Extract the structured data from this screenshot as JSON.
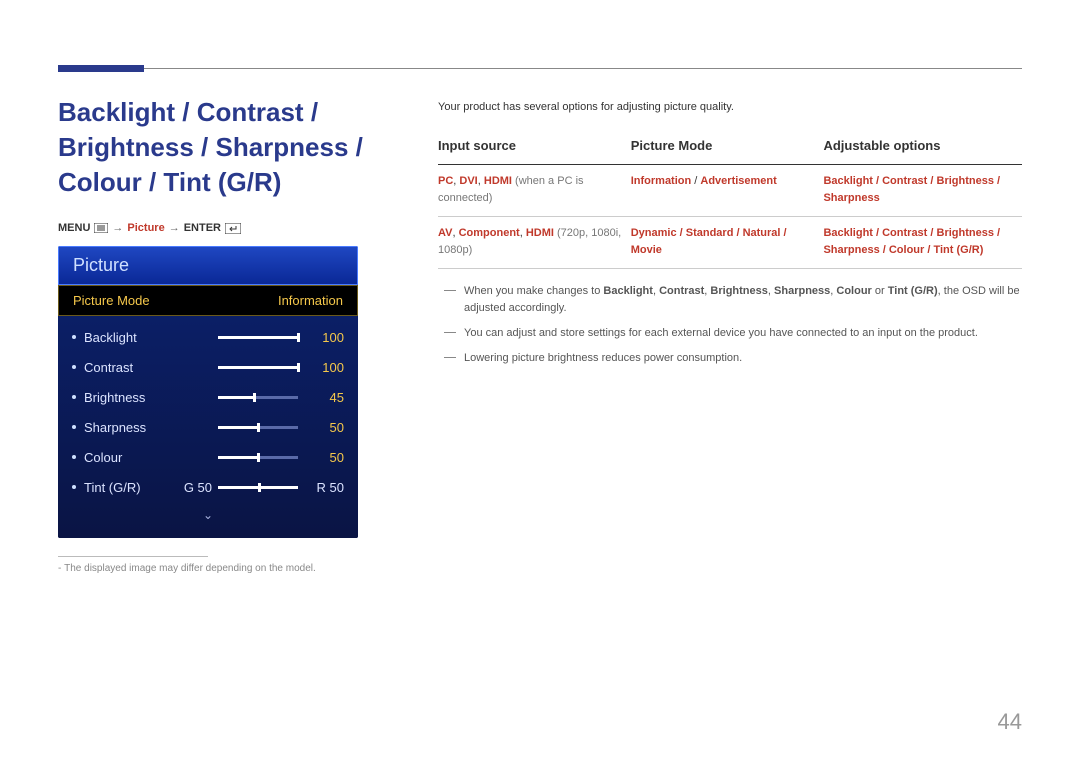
{
  "title": "Backlight / Contrast / Brightness / Sharpness / Colour / Tint (G/R)",
  "nav": {
    "menu": "MENU",
    "picture": "Picture",
    "enter": "ENTER"
  },
  "osd": {
    "header": "Picture",
    "mode_label": "Picture Mode",
    "mode_value": "Information",
    "rows": [
      {
        "label": "Backlight",
        "value": "100",
        "pct": 100
      },
      {
        "label": "Contrast",
        "value": "100",
        "pct": 100
      },
      {
        "label": "Brightness",
        "value": "45",
        "pct": 45
      },
      {
        "label": "Sharpness",
        "value": "50",
        "pct": 50
      },
      {
        "label": "Colour",
        "value": "50",
        "pct": 50
      }
    ],
    "tint": {
      "label": "Tint (G/R)",
      "g": "G 50",
      "r": "R 50"
    }
  },
  "footnote_prefix": "-",
  "footnote": "The displayed image may differ depending on the model.",
  "intro": "Your product has several options for adjusting picture quality.",
  "table": {
    "h1": "Input source",
    "h2": "Picture Mode",
    "h3": "Adjustable options",
    "r1c1a": "PC",
    "r1c1b": "DVI",
    "r1c1c": "HDMI",
    "r1c1_tail": " (when a PC is connected)",
    "r1c2a": "Information",
    "r1c2b": "Advertisement",
    "r1c3": "Backlight / Contrast / Brightness / Sharpness",
    "r2c1a": "AV",
    "r2c1b": "Component",
    "r2c1c": "HDMI",
    "r2c1_tail": " (720p, 1080i, 1080p)",
    "r2c2": "Dynamic / Standard / Natural / Movie",
    "r2c3": "Backlight / Contrast / Brightness / Sharpness / Colour / Tint (G/R)"
  },
  "notes": {
    "n1_head": "When you make changes to ",
    "n1_terms_backlight": "Backlight",
    "n1_terms_contrast": "Contrast",
    "n1_terms_brightness": "Brightness",
    "n1_terms_sharpness": "Sharpness",
    "n1_terms_colour": "Colour",
    "n1_or": " or ",
    "n1_terms_tint": "Tint (G/R)",
    "n1_tail": ", the OSD will be adjusted accordingly.",
    "n2": "You can adjust and store settings for each external device you have connected to an input on the product.",
    "n3": "Lowering picture brightness reduces power consumption."
  },
  "page": "44"
}
